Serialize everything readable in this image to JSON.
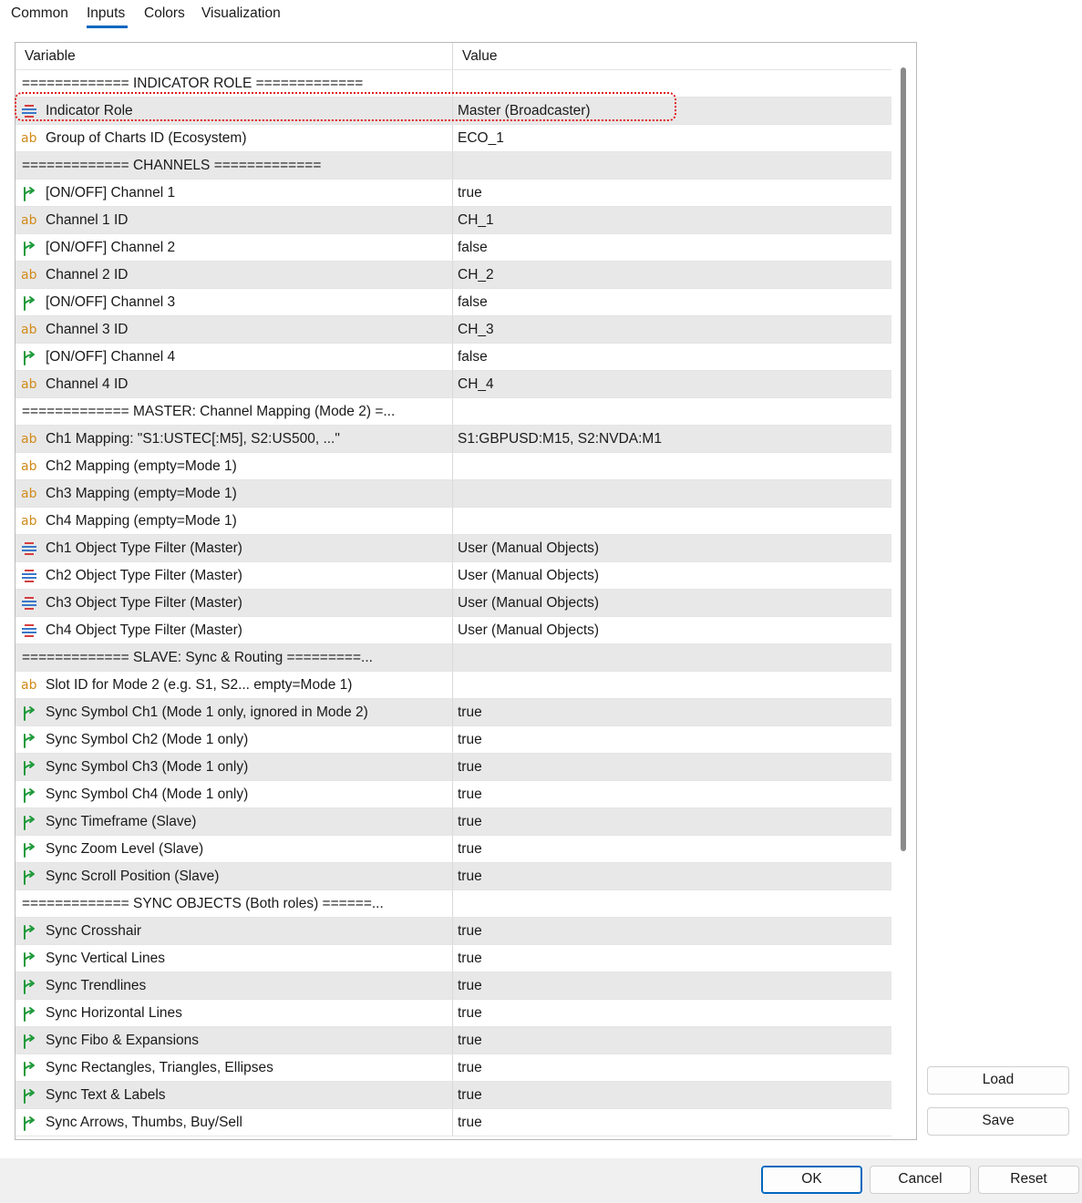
{
  "tabs": [
    {
      "label": "Common"
    },
    {
      "label": "Inputs"
    },
    {
      "label": "Colors"
    },
    {
      "label": "Visualization"
    }
  ],
  "table": {
    "col_variable": "Variable",
    "col_value": "Value",
    "rows": [
      {
        "type": "sep",
        "name": "=============  INDICATOR ROLE  =============",
        "value": ""
      },
      {
        "type": "enum",
        "name": "Indicator Role",
        "value": "Master (Broadcaster)"
      },
      {
        "type": "string",
        "name": "Group of Charts ID (Ecosystem)",
        "value": "ECO_1"
      },
      {
        "type": "sep",
        "name": "=============  CHANNELS  =============",
        "value": ""
      },
      {
        "type": "bool",
        "name": "[ON/OFF] Channel 1",
        "value": "true"
      },
      {
        "type": "string",
        "name": "Channel 1 ID",
        "value": "CH_1"
      },
      {
        "type": "bool",
        "name": "[ON/OFF] Channel 2",
        "value": "false"
      },
      {
        "type": "string",
        "name": "Channel 2 ID",
        "value": "CH_2"
      },
      {
        "type": "bool",
        "name": "[ON/OFF] Channel 3",
        "value": "false"
      },
      {
        "type": "string",
        "name": "Channel 3 ID",
        "value": "CH_3"
      },
      {
        "type": "bool",
        "name": "[ON/OFF] Channel 4",
        "value": "false"
      },
      {
        "type": "string",
        "name": "Channel 4 ID",
        "value": "CH_4"
      },
      {
        "type": "sep",
        "name": "=============  MASTER: Channel Mapping (Mode 2)  =...",
        "value": ""
      },
      {
        "type": "string",
        "name": "Ch1 Mapping: \"S1:USTEC[:M5], S2:US500, ...\"",
        "value": "S1:GBPUSD:M15, S2:NVDA:M1"
      },
      {
        "type": "string",
        "name": "Ch2 Mapping (empty=Mode 1)",
        "value": ""
      },
      {
        "type": "string",
        "name": "Ch3 Mapping (empty=Mode 1)",
        "value": ""
      },
      {
        "type": "string",
        "name": "Ch4 Mapping (empty=Mode 1)",
        "value": ""
      },
      {
        "type": "enum",
        "name": "Ch1 Object Type Filter (Master)",
        "value": "User (Manual Objects)"
      },
      {
        "type": "enum",
        "name": "Ch2 Object Type Filter (Master)",
        "value": "User (Manual Objects)"
      },
      {
        "type": "enum",
        "name": "Ch3 Object Type Filter (Master)",
        "value": "User (Manual Objects)"
      },
      {
        "type": "enum",
        "name": "Ch4 Object Type Filter (Master)",
        "value": "User (Manual Objects)"
      },
      {
        "type": "sep",
        "name": "=============  SLAVE: Sync & Routing  =========...",
        "value": ""
      },
      {
        "type": "string",
        "name": "Slot ID for Mode 2 (e.g. S1, S2... empty=Mode 1)",
        "value": ""
      },
      {
        "type": "bool",
        "name": "Sync Symbol Ch1 (Mode 1 only, ignored in Mode 2)",
        "value": "true"
      },
      {
        "type": "bool",
        "name": "Sync Symbol Ch2 (Mode 1 only)",
        "value": "true"
      },
      {
        "type": "bool",
        "name": "Sync Symbol Ch3 (Mode 1 only)",
        "value": "true"
      },
      {
        "type": "bool",
        "name": "Sync Symbol Ch4 (Mode 1 only)",
        "value": "true"
      },
      {
        "type": "bool",
        "name": "Sync Timeframe (Slave)",
        "value": "true"
      },
      {
        "type": "bool",
        "name": "Sync Zoom Level (Slave)",
        "value": "true"
      },
      {
        "type": "bool",
        "name": "Sync Scroll Position (Slave)",
        "value": "true"
      },
      {
        "type": "sep",
        "name": "=============  SYNC OBJECTS (Both roles)  ======...",
        "value": ""
      },
      {
        "type": "bool",
        "name": "Sync Crosshair",
        "value": "true"
      },
      {
        "type": "bool",
        "name": "Sync Vertical Lines",
        "value": "true"
      },
      {
        "type": "bool",
        "name": "Sync Trendlines",
        "value": "true"
      },
      {
        "type": "bool",
        "name": "Sync Horizontal Lines",
        "value": "true"
      },
      {
        "type": "bool",
        "name": "Sync Fibo & Expansions",
        "value": "true"
      },
      {
        "type": "bool",
        "name": "Sync Rectangles, Triangles, Ellipses",
        "value": "true"
      },
      {
        "type": "bool",
        "name": "Sync Text & Labels",
        "value": "true"
      },
      {
        "type": "bool",
        "name": "Sync Arrows, Thumbs, Buy/Sell",
        "value": "true"
      }
    ]
  },
  "side_buttons": {
    "load": "Load",
    "save": "Save"
  },
  "footer_buttons": {
    "ok": "OK",
    "cancel": "Cancel",
    "reset": "Reset"
  },
  "icons": {
    "enum": "enum-list-icon",
    "string": "ab-string-icon",
    "bool": "green-arrow-bool-icon"
  },
  "colors": {
    "accent": "#0067c0",
    "highlight": "#e02020",
    "row_shade": "#e8e8e8",
    "ab_icon": "#d18a1a",
    "bool_icon": "#1e9a3a"
  }
}
